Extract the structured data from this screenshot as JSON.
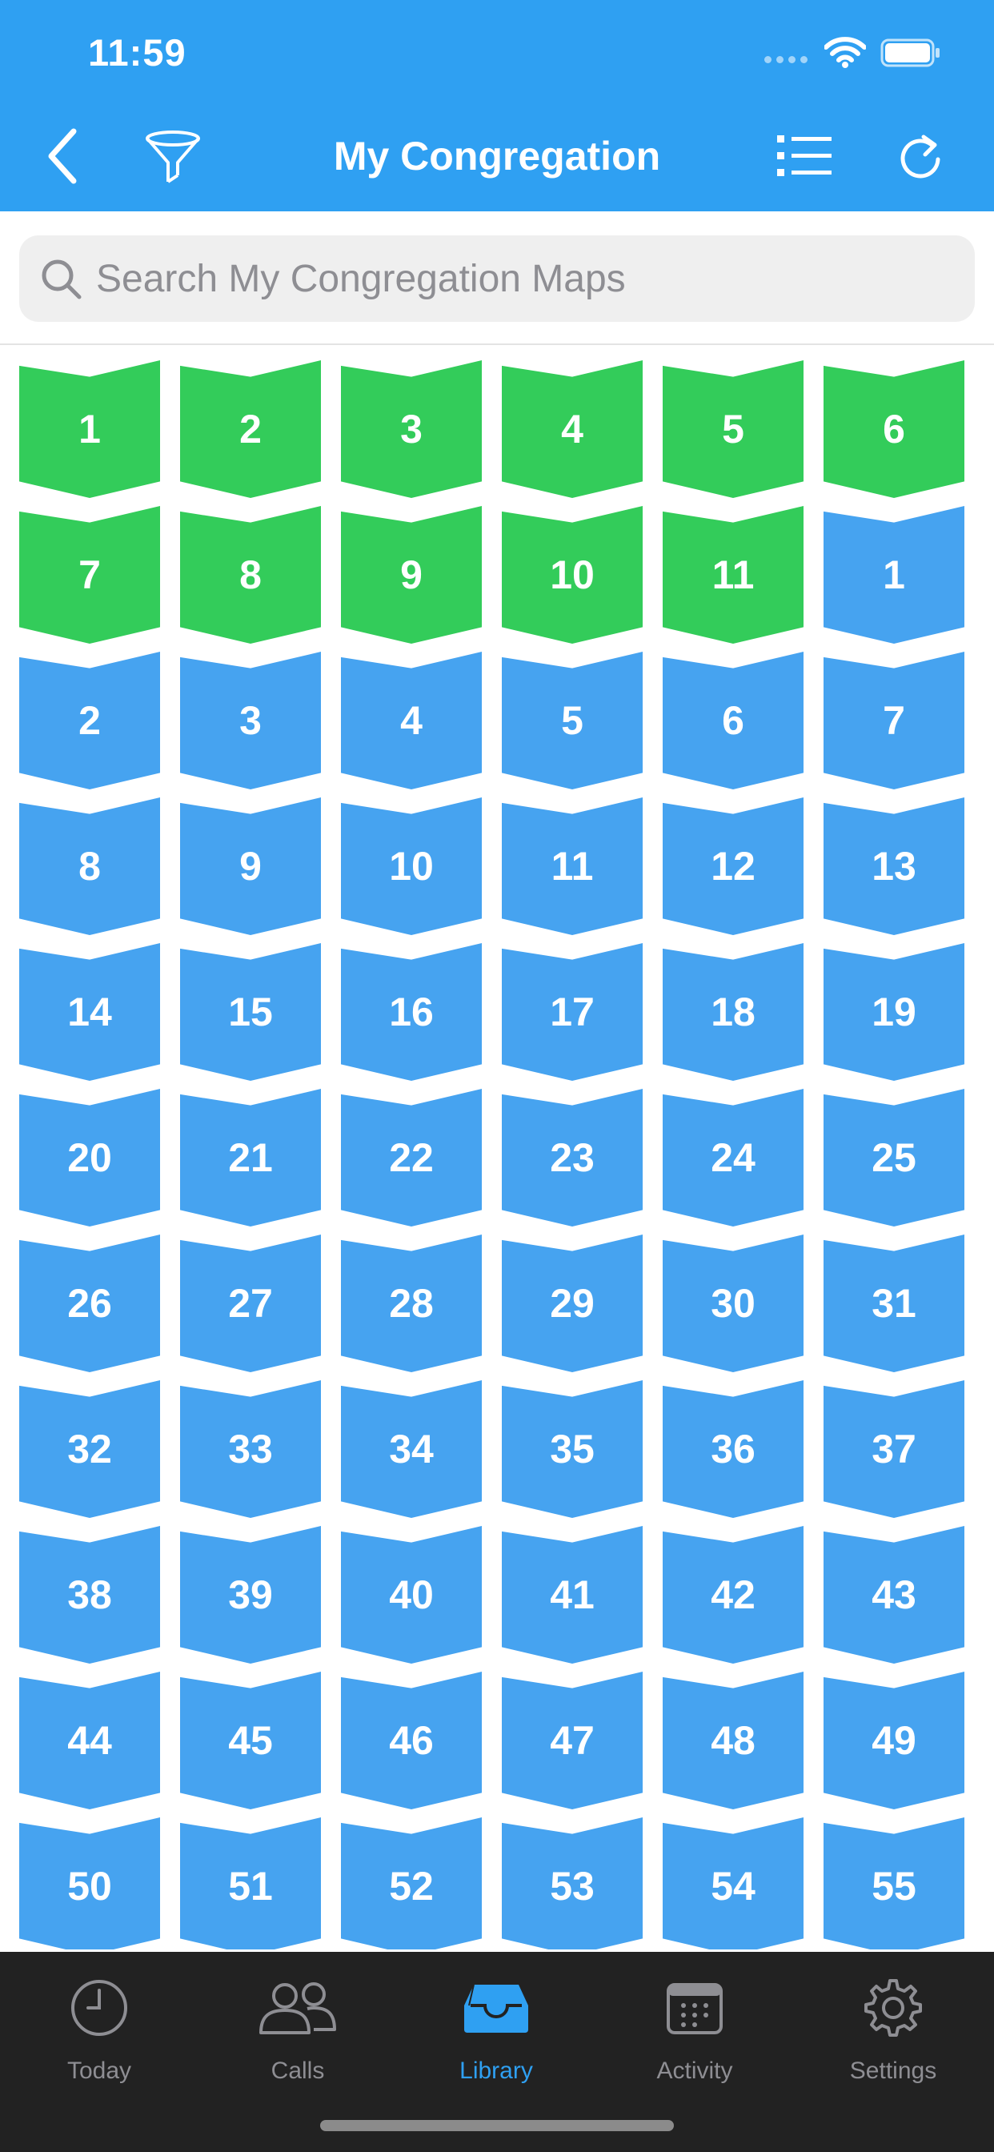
{
  "status_bar": {
    "time": "11:59"
  },
  "nav": {
    "title": "My Congregation"
  },
  "search": {
    "placeholder": "Search My Congregation Maps",
    "value": ""
  },
  "colors": {
    "header": "#2fa0f2",
    "green_tile": "#33cc5a",
    "blue_tile": "#46a3f0",
    "tabbar": "#222222",
    "active_tab": "#2fa0f2"
  },
  "maps": {
    "green": [
      "1",
      "2",
      "3",
      "4",
      "5",
      "6",
      "7",
      "8",
      "9",
      "10",
      "11"
    ],
    "blue": [
      "1",
      "2",
      "3",
      "4",
      "5",
      "6",
      "7",
      "8",
      "9",
      "10",
      "11",
      "12",
      "13",
      "14",
      "15",
      "16",
      "17",
      "18",
      "19",
      "20",
      "21",
      "22",
      "23",
      "24",
      "25",
      "26",
      "27",
      "28",
      "29",
      "30",
      "31",
      "32",
      "33",
      "34",
      "35",
      "36",
      "37",
      "38",
      "39",
      "40",
      "41",
      "42",
      "43",
      "44",
      "45",
      "46",
      "47",
      "48",
      "49",
      "50",
      "51",
      "52",
      "53",
      "54",
      "55"
    ]
  },
  "tabs": [
    {
      "label": "Today",
      "icon": "clock-icon",
      "active": false
    },
    {
      "label": "Calls",
      "icon": "people-icon",
      "active": false
    },
    {
      "label": "Library",
      "icon": "tray-icon",
      "active": true
    },
    {
      "label": "Activity",
      "icon": "calendar-icon",
      "active": false
    },
    {
      "label": "Settings",
      "icon": "gear-icon",
      "active": false
    }
  ]
}
